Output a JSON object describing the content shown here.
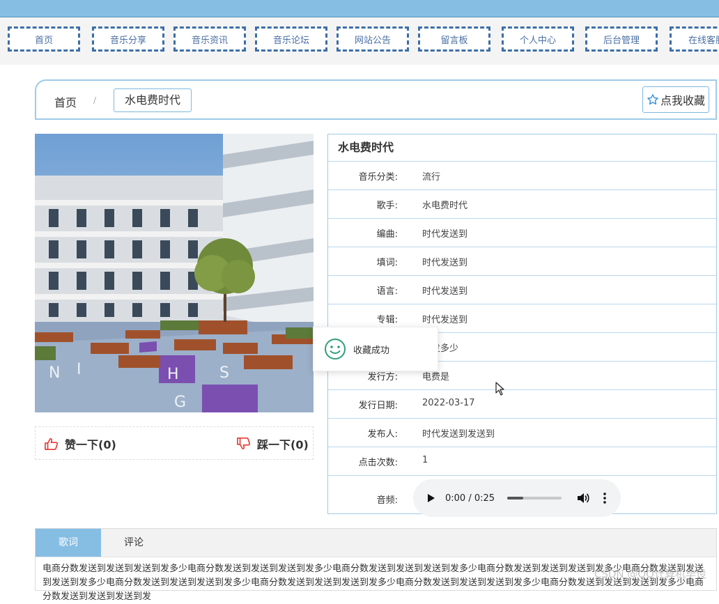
{
  "nav": {
    "items": [
      "首页",
      "音乐分享",
      "音乐资讯",
      "音乐论坛",
      "网站公告",
      "留言板",
      "个人中心",
      "后台管理",
      "在线客服"
    ]
  },
  "breadcrumb": {
    "home": "首页",
    "separator": "/",
    "current": "水电费时代"
  },
  "favorite": {
    "label": "点我收藏",
    "icon": "star-outline-icon"
  },
  "vote": {
    "like_label": "赞一下(0)",
    "dislike_label": "踩一下(0)",
    "like_icon": "thumbs-up-icon",
    "dislike_icon": "thumbs-down-icon"
  },
  "detail": {
    "title": "水电费时代",
    "rows": [
      {
        "label": "音乐分类:",
        "value": "流行"
      },
      {
        "label": "歌手:",
        "value": "水电费时代"
      },
      {
        "label": "编曲:",
        "value": "时代发送到"
      },
      {
        "label": "填词:",
        "value": "时代发送到"
      },
      {
        "label": "语言:",
        "value": "时代发送到"
      },
      {
        "label": "专辑:",
        "value": "时代发送到"
      },
      {
        "label": "",
        "value": "代发多少"
      },
      {
        "label": "发行方:",
        "value": "电费是"
      },
      {
        "label": "发行日期:",
        "value": "2022-03-17"
      },
      {
        "label": "发布人:",
        "value": "时代发送到发送到"
      },
      {
        "label": "点击次数:",
        "value": "1"
      }
    ],
    "audio_label": "音频:",
    "audio_time": "0:00 / 0:25",
    "audio_progress": 0.3
  },
  "toast": {
    "message": "收藏成功",
    "icon": "smile-icon"
  },
  "tabs": {
    "items": [
      "歌词",
      "评论"
    ],
    "active": "歌词"
  },
  "lyrics": "电商分数发送到发送到发送到发多少电商分数发送到发送到发送到发多少电商分数发送到发送到发送到发多少电商分数发送到发送到发送到发多少电商分数发送到发送到发送到发多少电商分数发送到发送到发送到发多少电商分数发送到发送到发送到发多少电商分数发送到发送到发送到发多少电商分数发送到发送到发送到发多少电商分数发送到发送到发送到发",
  "watermark": "CSDN @QQ计算机毕设",
  "colors": {
    "accent": "#86bde3",
    "nav_border": "#3d6fa6",
    "vote_icon": "#e53935",
    "toast_icon": "#2e9e7a"
  }
}
